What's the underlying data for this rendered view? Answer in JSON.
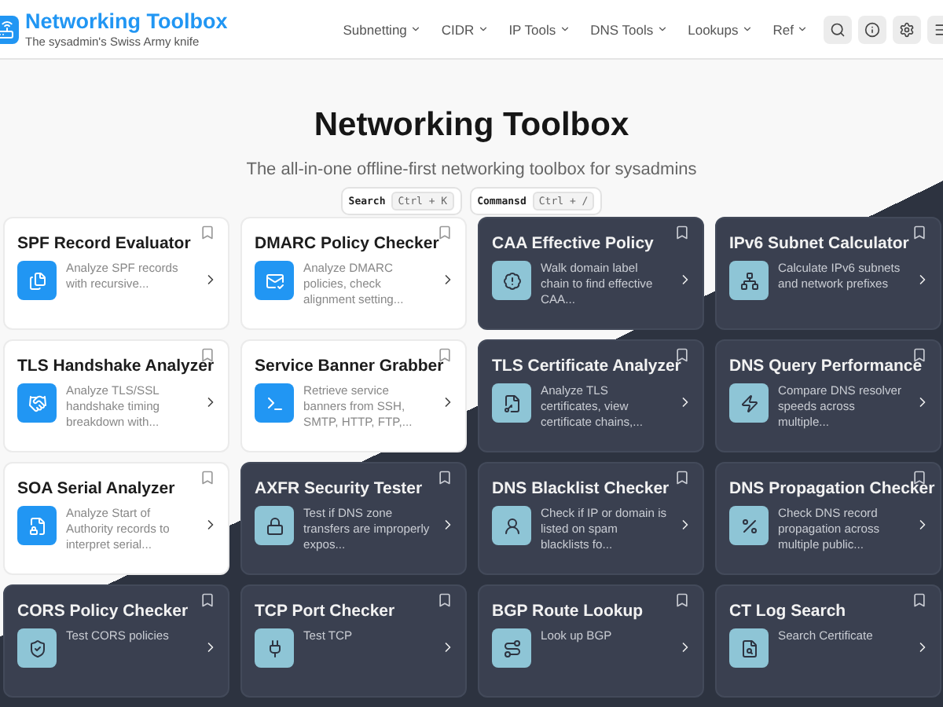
{
  "header": {
    "brand": "Networking Toolbox",
    "tagline": "The sysadmin's Swiss Army knife",
    "nav": [
      "Subnetting",
      "CIDR",
      "IP Tools",
      "DNS Tools",
      "Lookups",
      "Ref"
    ]
  },
  "hero": {
    "title": "Networking Toolbox",
    "subtitle": "The all-in-one offline-first networking toolbox for sysadmins",
    "shortcuts": [
      {
        "label": "Search",
        "keys": "Ctrl + K"
      },
      {
        "label": "Commansd",
        "keys": "Ctrl + /"
      }
    ]
  },
  "cards": [
    {
      "title": "SPF Record Evaluator",
      "description": "Analyze SPF records with recursive...",
      "dark": false
    },
    {
      "title": "DMARC Policy Checker",
      "description": "Analyze DMARC policies, check alignment setting...",
      "dark": false
    },
    {
      "title": "CAA Effective Policy",
      "description": "Walk domain label chain to find effective CAA...",
      "dark": true
    },
    {
      "title": "IPv6 Subnet Calculator",
      "description": "Calculate IPv6 subnets and network prefixes",
      "dark": true
    },
    {
      "title": "TLS Handshake Analyzer",
      "description": "Analyze TLS/SSL handshake timing breakdown with...",
      "dark": false
    },
    {
      "title": "Service Banner Grabber",
      "description": "Retrieve service banners from SSH, SMTP, HTTP, FTP,...",
      "dark": false
    },
    {
      "title": "TLS Certificate Analyzer",
      "description": "Analyze TLS certificates, view certificate chains,...",
      "dark": true
    },
    {
      "title": "DNS Query Performance",
      "description": "Compare DNS resolver speeds across multiple...",
      "dark": true
    },
    {
      "title": "SOA Serial Analyzer",
      "description": "Analyze Start of Authority records to interpret serial...",
      "dark": false
    },
    {
      "title": "AXFR Security Tester",
      "description": "Test if DNS zone transfers are improperly expos...",
      "dark": true
    },
    {
      "title": "DNS Blacklist Checker",
      "description": "Check if IP or domain is listed on spam blacklists fo...",
      "dark": true
    },
    {
      "title": "DNS Propagation Checker",
      "description": "Check DNS record propagation across multiple public...",
      "dark": true
    },
    {
      "title": "CORS Policy Checker",
      "description": "Test CORS policies",
      "dark": true
    },
    {
      "title": "TCP Port Checker",
      "description": "Test TCP",
      "dark": true
    },
    {
      "title": "BGP Route Lookup",
      "description": "Look up BGP",
      "dark": true
    },
    {
      "title": "CT Log Search",
      "description": "Search Certificate",
      "dark": true
    }
  ]
}
